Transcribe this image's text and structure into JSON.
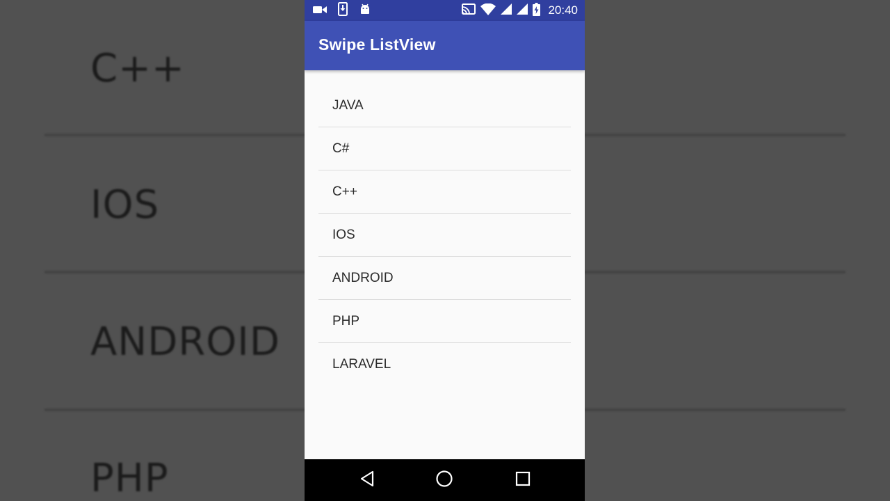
{
  "background": {
    "items": [
      "C++",
      "IOS",
      "ANDROID",
      "PHP"
    ]
  },
  "status_bar": {
    "time": "20:40",
    "left_icons": [
      "video-camera-icon",
      "phone-download-icon",
      "android-icon"
    ],
    "right_icons": [
      "cast-icon",
      "wifi-icon",
      "signal-icon",
      "signal-icon",
      "battery-charging-icon"
    ]
  },
  "app_bar": {
    "title": "Swipe ListView"
  },
  "list": {
    "items": [
      "JAVA",
      "C#",
      "C++",
      "IOS",
      "ANDROID",
      "PHP",
      "LARAVEL"
    ]
  },
  "nav_bar": {
    "buttons": [
      "back-icon",
      "home-icon",
      "recents-icon"
    ]
  },
  "colors": {
    "status_bar": "#303f9f",
    "app_bar": "#3f51b5",
    "list_background": "#fafafa",
    "divider": "#dcdcdc",
    "nav_bar": "#000000"
  }
}
